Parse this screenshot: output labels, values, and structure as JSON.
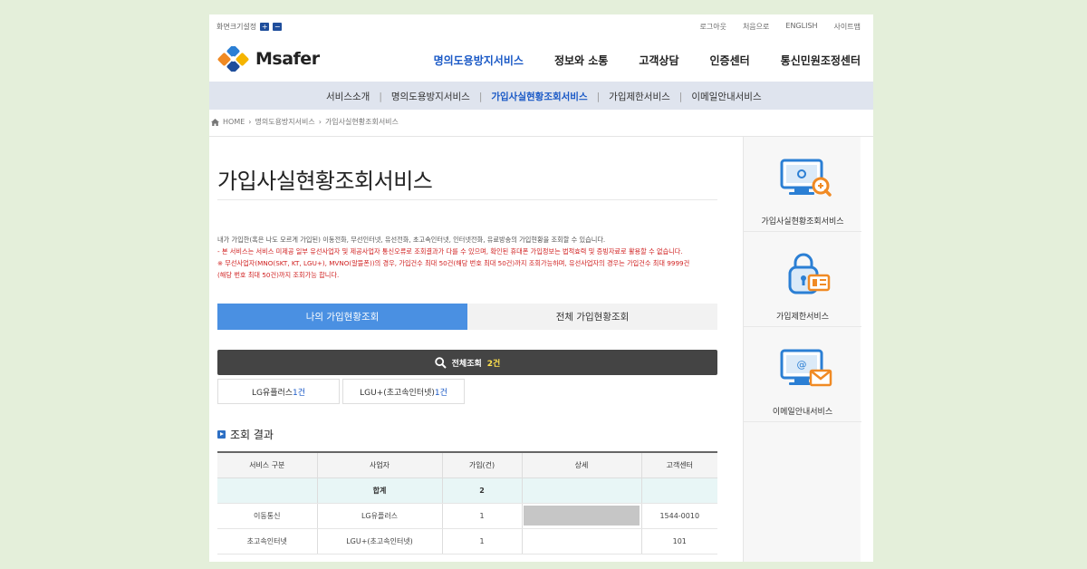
{
  "util": {
    "font_size_label": "화면크기설정",
    "plus": "+",
    "minus": "−",
    "links": [
      "로그아웃",
      "처음으로",
      "ENGLISH",
      "사이트맵"
    ]
  },
  "brand": {
    "name": "Msafer"
  },
  "gnb": {
    "items": [
      "명의도용방지서비스",
      "정보와 소통",
      "고객상담",
      "인증센터",
      "통신민원조정센터"
    ],
    "active_index": 0
  },
  "lnb": {
    "items": [
      "서비스소개",
      "명의도용방지서비스",
      "가입사실현황조회서비스",
      "가입제한서비스",
      "이메일안내서비스"
    ],
    "active_index": 2
  },
  "breadcrumb": [
    "HOME",
    "명의도용방지서비스",
    "가입사실현황조회서비스"
  ],
  "page_title": "가입사실현황조회서비스",
  "description": {
    "line1": "내가 가입한(혹은 나도 모르게 가입된) 이동전화, 무선인터넷, 유선전화, 초고속인터넷, 인터넷전화, 유료방송의 가입현황을 조회할 수 있습니다.",
    "line2": "- 본 서비스는 서비스 미제공 일부 유선사업자 및 제공사업자 통신오류로 조회결과가 다를 수 있으며, 확인된 휴대폰 가입정보는 법적효력 및 증빙자료로 활용할 수 없습니다.",
    "line3": "※ 무선사업자(MNO(SKT, KT, LGU+), MVNO(알뜰폰))의 경우, 가입건수 최대 50건(해당 번호 최대 50건)까지 조회가능하며, 유선사업자의 경우는 가입건수 최대 9999건",
    "line4": "(해당 번호 최대 50건)까지 조회가능 합니다."
  },
  "tabs": {
    "my": "나의 가입현황조회",
    "all": "전체 가입현황조회"
  },
  "search": {
    "label": "전체조회",
    "count": "2건"
  },
  "chips": [
    {
      "label": "LG유플러스",
      "count": "1건"
    },
    {
      "label": "LGU+(초고속인터넷)",
      "count": "1건"
    }
  ],
  "results": {
    "section_title": "조회 결과",
    "headers": [
      "서비스 구분",
      "사업자",
      "가입(건)",
      "상세",
      "고객센터"
    ],
    "total": {
      "label": "합계",
      "count": "2"
    },
    "rows": [
      {
        "service": "이동통신",
        "carrier": "LG유플러스",
        "count": "1",
        "center": "1544-0010"
      },
      {
        "service": "초고속인터넷",
        "carrier": "LGU+(초고속인터넷)",
        "count": "1",
        "center": "101"
      }
    ]
  },
  "sidebar": {
    "items": [
      {
        "label": "가입사실현황조회서비스",
        "icon": "monitor-search-icon"
      },
      {
        "label": "가입제한서비스",
        "icon": "padlock-card-icon"
      },
      {
        "label": "이메일안내서비스",
        "icon": "monitor-mail-icon"
      }
    ]
  },
  "colors": {
    "accent": "#1a59c6",
    "tab_active": "#4a90e2",
    "notice_red": "#d02121",
    "icon_blue": "#2b7fd4",
    "icon_orange": "#f08a24",
    "background": "#e4efda"
  }
}
